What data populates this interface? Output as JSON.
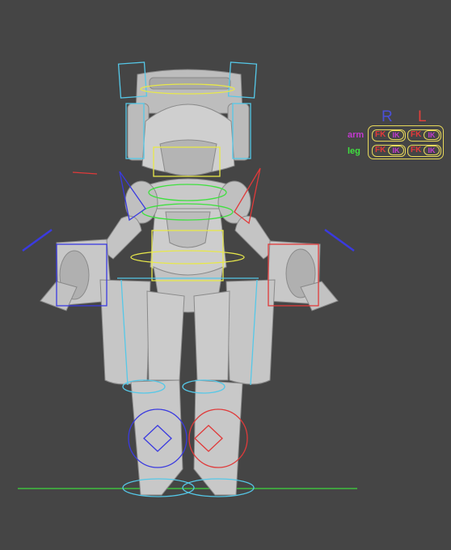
{
  "viewport": {
    "background": "#454545",
    "model_color": "#c7c7c7",
    "ground_line_color": "#3fd83f"
  },
  "ik_fk_switch": {
    "right_header": "R",
    "left_header": "L",
    "rows": [
      {
        "label": "arm",
        "right": {
          "fk": "FK",
          "ik": "IK"
        },
        "left": {
          "fk": "FK",
          "ik": "IK"
        }
      },
      {
        "label": "leg",
        "right": {
          "fk": "FK",
          "ik": "IK"
        },
        "left": {
          "fk": "FK",
          "ik": "IK"
        }
      }
    ],
    "colors": {
      "right": "#4a4fd8",
      "left": "#e0403a",
      "arm": "#c33ad0",
      "leg": "#3fe03f",
      "frame": "#e8d95a"
    }
  },
  "controls": {
    "right_side_color": "#3a3ae0",
    "left_side_color": "#e03a3a",
    "center_color": "#e8e84a",
    "cyan_color": "#55c8e8",
    "spine_color": "#3fe03f"
  }
}
